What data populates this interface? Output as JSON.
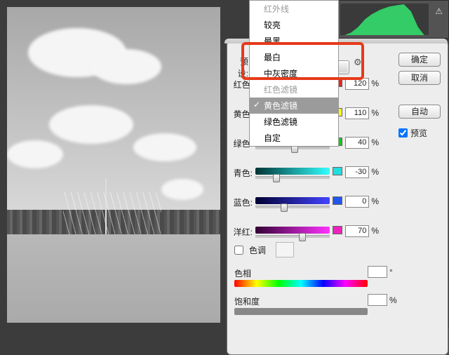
{
  "menu": {
    "items": [
      {
        "label": "红外线",
        "dim": true
      },
      {
        "label": "较亮"
      },
      {
        "label": "最黑"
      },
      {
        "label": "最白"
      },
      {
        "label": "中灰密度"
      },
      {
        "label": "红色滤镜",
        "dim": true
      },
      {
        "label": "黄色滤镜",
        "selected": true
      },
      {
        "label": "绿色滤镜"
      },
      {
        "label": "自定"
      }
    ]
  },
  "dialog": {
    "preset_label": "预设:",
    "preset_value": "黄色滤镜",
    "buttons": {
      "ok": "确定",
      "cancel": "取消",
      "auto": "自动"
    },
    "preview_label": "预览",
    "preview_checked": true,
    "sliders": [
      {
        "label": "红色:",
        "value": "120",
        "pos": 85,
        "grad": "grad-red",
        "swatch": "sw-red"
      },
      {
        "label": "黄色:",
        "value": "110",
        "pos": 80,
        "grad": "grad-yellow",
        "swatch": "sw-yellow"
      },
      {
        "label": "绿色:",
        "value": "40",
        "pos": 53,
        "grad": "grad-green",
        "swatch": "sw-green"
      },
      {
        "label": "青色:",
        "value": "-30",
        "pos": 28,
        "grad": "grad-cyan",
        "swatch": "sw-cyan"
      },
      {
        "label": "蓝色:",
        "value": "0",
        "pos": 39,
        "grad": "grad-blue",
        "swatch": "sw-blue"
      },
      {
        "label": "洋红:",
        "value": "70",
        "pos": 63,
        "grad": "grad-magenta",
        "swatch": "sw-magenta"
      }
    ],
    "tint": {
      "label": "色调",
      "checked": false
    },
    "hue": {
      "label": "色相",
      "value": "",
      "unit": "°"
    },
    "saturation": {
      "label": "饱和度",
      "value": "",
      "unit": "%"
    }
  },
  "histogram": {
    "warning_icon": "⚠"
  }
}
